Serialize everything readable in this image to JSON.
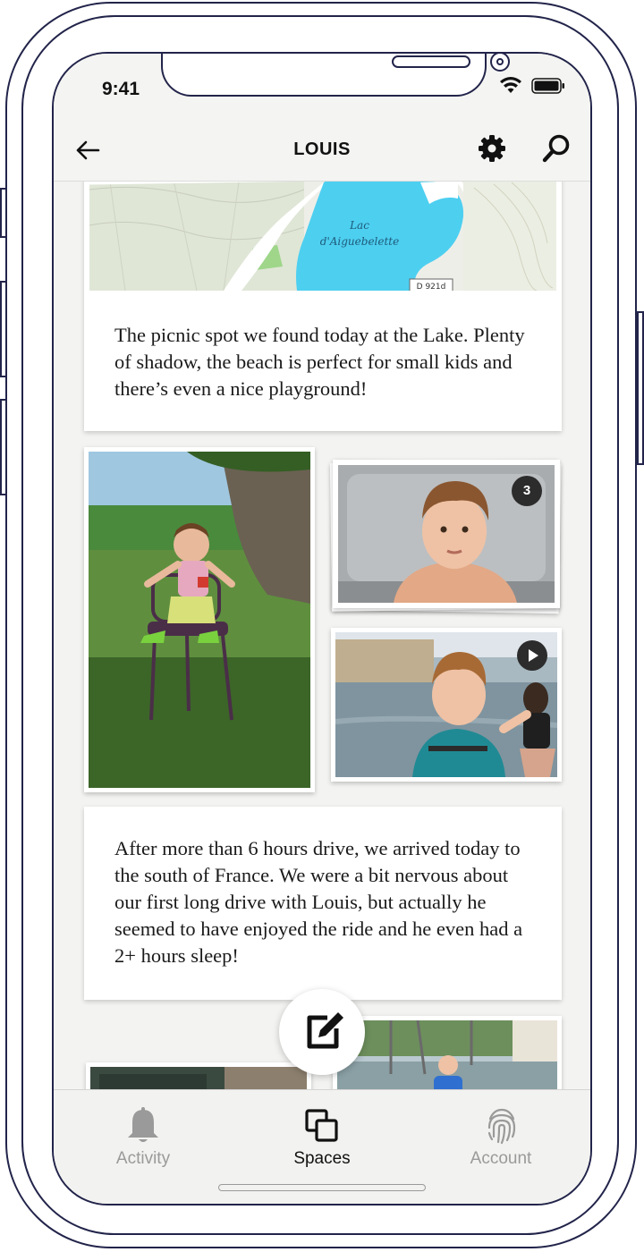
{
  "status_bar": {
    "time": "9:41"
  },
  "header": {
    "title": "LOUIS"
  },
  "map": {
    "lake_label_line1": "Lac",
    "lake_label_line2": "d'Aiguebelette",
    "road_label": "D 921d"
  },
  "posts": [
    {
      "text": "The picnic spot we found today at the Lake. Plenty of shadow, the beach is perfect for small kids and there’s even a nice playground!"
    },
    {
      "text": "After more than 6 hours drive, we arrived today to the south of France. We were a bit nervous about our first long drive with Louis, but actually he seemed to have enjoyed the ride and he even had a 2+ hours sleep!"
    }
  ],
  "gallery": {
    "stack_count": "3"
  },
  "tabs": [
    {
      "label": "Activity",
      "icon": "bell-icon",
      "active": false
    },
    {
      "label": "Spaces",
      "icon": "spaces-icon",
      "active": true
    },
    {
      "label": "Account",
      "icon": "fingerprint-icon",
      "active": false
    }
  ],
  "colors": {
    "lake": "#4dcff0",
    "text": "#1a1a1a",
    "inactive_tab": "#9a9a9a",
    "frame": "#22244a"
  }
}
